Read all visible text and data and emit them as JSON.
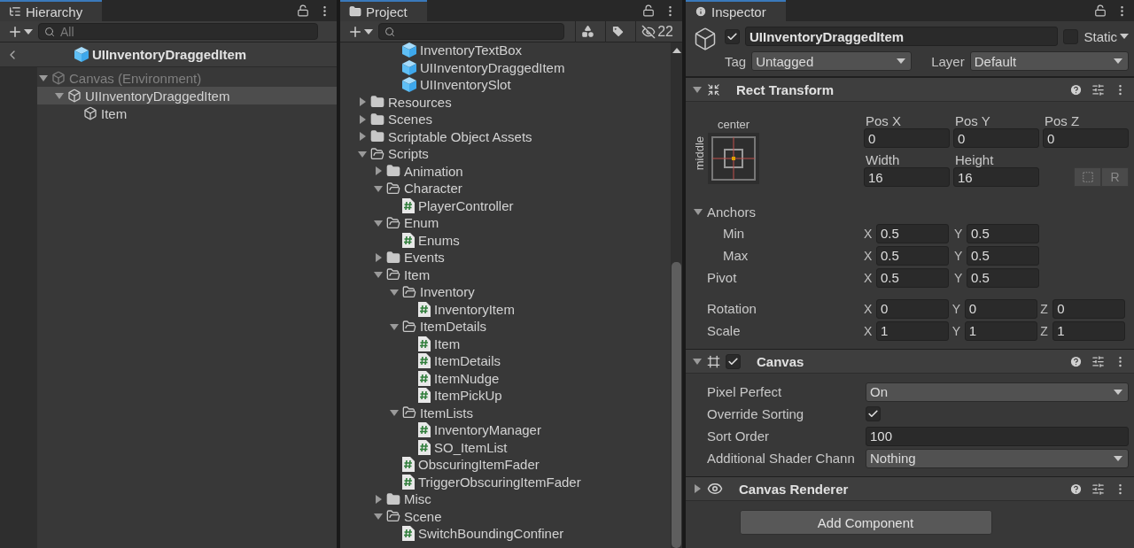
{
  "hierarchy": {
    "tab": "Hierarchy",
    "search": {
      "placeholder": "All"
    },
    "prefab_title": "UIInventoryDraggedItem",
    "tree": [
      {
        "label": "Canvas (Environment)",
        "disabled": true,
        "selected": false,
        "expanded": true,
        "children": [
          {
            "label": "UIInventoryDraggedItem",
            "disabled": false,
            "selected": true,
            "expanded": true,
            "children": [
              {
                "label": "Item",
                "disabled": false,
                "selected": false
              }
            ]
          }
        ]
      }
    ]
  },
  "project": {
    "tab": "Project",
    "hidden_count": "22",
    "continued_items": [
      {
        "kind": "prefab",
        "label": "InventoryTextBox"
      },
      {
        "kind": "prefab",
        "label": "UIInventoryDraggedItem"
      },
      {
        "kind": "prefab",
        "label": "UIInventorySlot"
      }
    ],
    "tree": [
      {
        "kind": "folder",
        "label": "Resources",
        "expanded": false
      },
      {
        "kind": "folder",
        "label": "Scenes",
        "expanded": false
      },
      {
        "kind": "folder",
        "label": "Scriptable Object Assets",
        "expanded": false
      },
      {
        "kind": "folder",
        "label": "Scripts",
        "expanded": true,
        "children": [
          {
            "kind": "folder",
            "label": "Animation",
            "expanded": false
          },
          {
            "kind": "folder",
            "label": "Character",
            "expanded": true,
            "children": [
              {
                "kind": "script",
                "label": "PlayerController"
              }
            ]
          },
          {
            "kind": "folder",
            "label": "Enum",
            "expanded": true,
            "children": [
              {
                "kind": "script",
                "label": "Enums"
              }
            ]
          },
          {
            "kind": "folder",
            "label": "Events",
            "expanded": false
          },
          {
            "kind": "folder",
            "label": "Item",
            "expanded": true,
            "children": [
              {
                "kind": "folder",
                "label": "Inventory",
                "expanded": true,
                "children": [
                  {
                    "kind": "script",
                    "label": "InventoryItem"
                  }
                ]
              },
              {
                "kind": "folder",
                "label": "ItemDetails",
                "expanded": true,
                "children": [
                  {
                    "kind": "script",
                    "label": "Item"
                  },
                  {
                    "kind": "script",
                    "label": "ItemDetails"
                  },
                  {
                    "kind": "script",
                    "label": "ItemNudge"
                  },
                  {
                    "kind": "script",
                    "label": "ItemPickUp"
                  }
                ]
              },
              {
                "kind": "folder",
                "label": "ItemLists",
                "expanded": true,
                "children": [
                  {
                    "kind": "script",
                    "label": "InventoryManager"
                  },
                  {
                    "kind": "script",
                    "label": "SO_ItemList"
                  }
                ]
              },
              {
                "kind": "script",
                "label": "ObscuringItemFader"
              },
              {
                "kind": "script",
                "label": "TriggerObscuringItemFader"
              }
            ]
          },
          {
            "kind": "folder",
            "label": "Misc",
            "expanded": false
          },
          {
            "kind": "folder",
            "label": "Scene",
            "expanded": true,
            "children": [
              {
                "kind": "script",
                "label": "SwitchBoundingConfiner"
              }
            ]
          }
        ]
      }
    ]
  },
  "inspector": {
    "tab": "Inspector",
    "object": {
      "active": true,
      "name": "UIInventoryDraggedItem",
      "static": false,
      "static_label": "Static",
      "tag_label": "Tag",
      "tag": "Untagged",
      "layer_label": "Layer",
      "layer": "Default"
    },
    "rect_transform": {
      "title": "Rect Transform",
      "expanded": true,
      "anchor_h": "center",
      "anchor_v": "middle",
      "position": [
        {
          "label": "Pos X",
          "value": "0"
        },
        {
          "label": "Pos Y",
          "value": "0"
        },
        {
          "label": "Pos Z",
          "value": "0"
        }
      ],
      "size": [
        {
          "label": "Width",
          "value": "16"
        },
        {
          "label": "Height",
          "value": "16"
        }
      ],
      "raw_button": "R",
      "anchors": {
        "label": "Anchors",
        "expanded": true,
        "rows": [
          {
            "label": "Min",
            "fields": [
              {
                "axis": "X",
                "value": "0.5"
              },
              {
                "axis": "Y",
                "value": "0.5"
              }
            ]
          },
          {
            "label": "Max",
            "fields": [
              {
                "axis": "X",
                "value": "0.5"
              },
              {
                "axis": "Y",
                "value": "0.5"
              }
            ]
          }
        ]
      },
      "vectors": [
        {
          "label": "Pivot",
          "fields": [
            {
              "axis": "X",
              "value": "0.5"
            },
            {
              "axis": "Y",
              "value": "0.5"
            }
          ]
        },
        {
          "label": "Rotation",
          "fields": [
            {
              "axis": "X",
              "value": "0"
            },
            {
              "axis": "Y",
              "value": "0"
            },
            {
              "axis": "Z",
              "value": "0"
            }
          ]
        },
        {
          "label": "Scale",
          "fields": [
            {
              "axis": "X",
              "value": "1"
            },
            {
              "axis": "Y",
              "value": "1"
            },
            {
              "axis": "Z",
              "value": "1"
            }
          ]
        }
      ]
    },
    "canvas": {
      "title": "Canvas",
      "enabled": true,
      "expanded": true,
      "properties": [
        {
          "kind": "dropdown",
          "label": "Pixel Perfect",
          "value": "On"
        },
        {
          "kind": "checkbox",
          "label": "Override Sorting",
          "checked": true
        },
        {
          "kind": "number",
          "label": "Sort Order",
          "value": "100"
        },
        {
          "kind": "dropdown",
          "label": "Additional Shader Chann",
          "value": "Nothing"
        }
      ]
    },
    "canvas_renderer": {
      "title": "Canvas Renderer",
      "expanded": false
    },
    "add_component": "Add Component"
  }
}
